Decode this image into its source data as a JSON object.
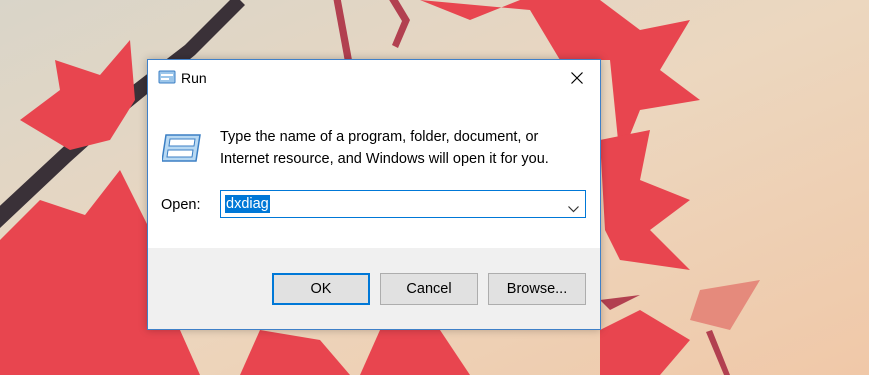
{
  "dialog": {
    "title": "Run",
    "description": "Type the name of a program, folder, document, or Internet resource, and Windows will open it for you.",
    "open_label": "Open:",
    "input_value": "dxdiag",
    "buttons": {
      "ok": "OK",
      "cancel": "Cancel",
      "browse": "Browse..."
    },
    "icons": {
      "title": "run-icon",
      "body": "run-program-icon",
      "close": "close-icon",
      "dropdown": "chevron-down-icon"
    }
  },
  "colors": {
    "accent": "#0078d7",
    "dialog_border": "#3f80c8",
    "footer": "#f0f0f0",
    "button_face": "#e1e1e1",
    "wallpaper_leaf": "#e8454f",
    "wallpaper_bg": "#e9d3bd"
  }
}
